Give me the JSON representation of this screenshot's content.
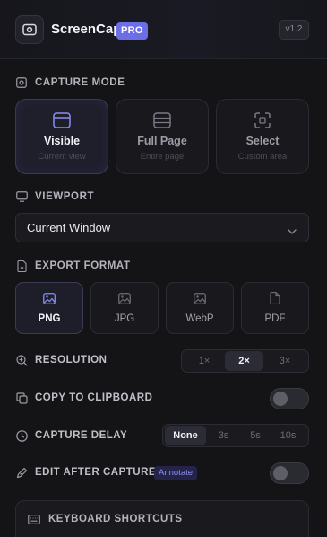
{
  "header": {
    "brand": "ScreenCap",
    "badge": "PRO",
    "version": "v1.2"
  },
  "capture_mode": {
    "heading": "CAPTURE MODE",
    "options": [
      {
        "title": "Visible",
        "subtitle": "Current view",
        "icon": "window-icon",
        "active": true
      },
      {
        "title": "Full Page",
        "subtitle": "Entire page",
        "icon": "page-icon",
        "active": false
      },
      {
        "title": "Select",
        "subtitle": "Custom area",
        "icon": "crop-icon",
        "active": false
      }
    ]
  },
  "viewport": {
    "heading": "VIEWPORT",
    "selected": "Current Window"
  },
  "export_format": {
    "heading": "EXPORT FORMAT",
    "options": [
      {
        "label": "PNG",
        "active": true
      },
      {
        "label": "JPG",
        "active": false
      },
      {
        "label": "WebP",
        "active": false
      },
      {
        "label": "PDF",
        "active": false
      }
    ]
  },
  "resolution": {
    "label": "RESOLUTION",
    "options": [
      "1×",
      "2×",
      "3×"
    ],
    "selected": "2×"
  },
  "clipboard": {
    "label": "COPY TO CLIPBOARD",
    "enabled": false
  },
  "delay": {
    "label": "CAPTURE DELAY",
    "options": [
      "None",
      "3s",
      "5s",
      "10s"
    ],
    "selected": "None"
  },
  "edit": {
    "label": "EDIT AFTER CAPTURE",
    "badge": "Annotate",
    "enabled": false
  },
  "shortcuts": {
    "heading": "KEYBOARD SHORTCUTS"
  },
  "colors": {
    "accent": "#6c6ee6",
    "background": "#141417",
    "card": "#18181d"
  }
}
